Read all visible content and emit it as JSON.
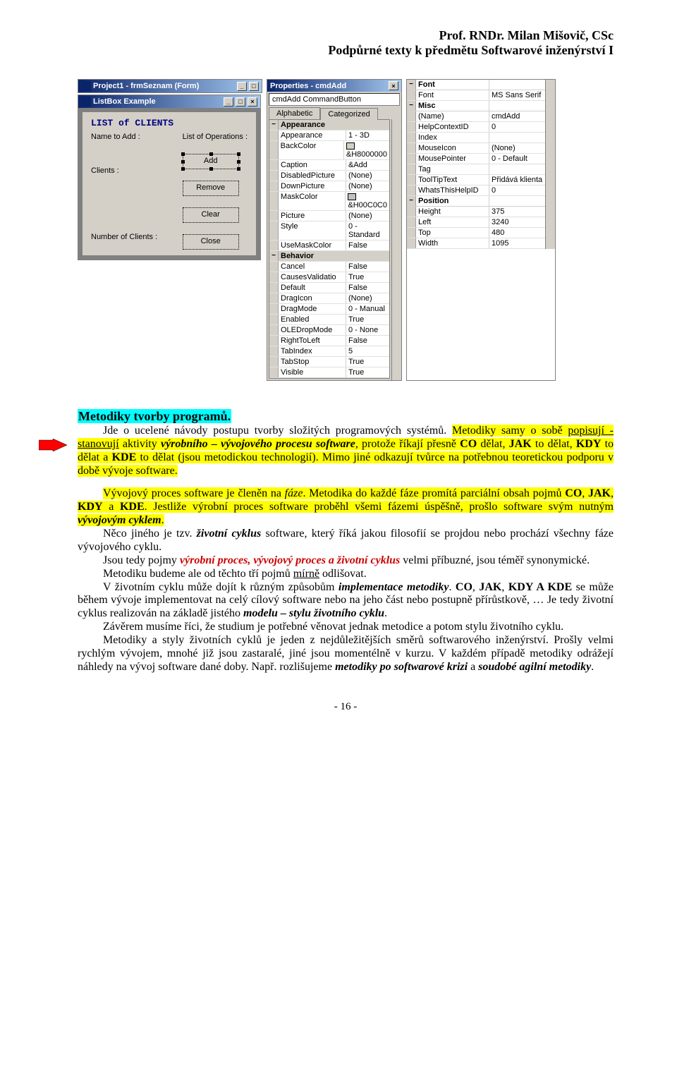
{
  "header": {
    "l1": "Prof. RNDr. Milan  Mišovič, CSc",
    "l2": "Podpůrné texty k předmětu  Softwarové inženýrství I"
  },
  "form1": {
    "title": "Project1 - frmSeznam (Form)",
    "btns": {
      "min": "_",
      "max": "□"
    }
  },
  "listbox": {
    "title": "ListBox Example",
    "btns": {
      "min": "_",
      "max": "□",
      "close": "×"
    },
    "caption": "LIST  of  CLIENTS",
    "ops_label": "List of Operations :",
    "name_label": "Name to Add :",
    "clients_label": "Clients :",
    "num_label": "Number of Clients :",
    "btn_add": "Add",
    "btn_remove": "Remove",
    "btn_clear": "Clear",
    "btn_close": "Close"
  },
  "prop": {
    "title": "Properties - cmdAdd",
    "close": "×",
    "combo": "cmdAdd  CommandButton",
    "tab_a": "Alphabetic",
    "tab_c": "Categorized",
    "minus": "−",
    "cats": {
      "app": "Appearance",
      "beh": "Behavior"
    },
    "rows": [
      {
        "k": "Appearance",
        "v": "1 - 3D"
      },
      {
        "k": "BackColor",
        "v": "&H8000000"
      },
      {
        "k": "Caption",
        "v": "&Add"
      },
      {
        "k": "DisabledPicture",
        "v": "(None)"
      },
      {
        "k": "DownPicture",
        "v": "(None)"
      },
      {
        "k": "MaskColor",
        "v": "&H00C0C0"
      },
      {
        "k": "Picture",
        "v": "(None)"
      },
      {
        "k": "Style",
        "v": "0 - Standard"
      },
      {
        "k": "UseMaskColor",
        "v": "False"
      },
      {
        "k": "Cancel",
        "v": "False"
      },
      {
        "k": "CausesValidatio",
        "v": "True"
      },
      {
        "k": "Default",
        "v": "False"
      },
      {
        "k": "DragIcon",
        "v": "(None)"
      },
      {
        "k": "DragMode",
        "v": "0 - Manual"
      },
      {
        "k": "Enabled",
        "v": "True"
      },
      {
        "k": "OLEDropMode",
        "v": "0 - None"
      },
      {
        "k": "RightToLeft",
        "v": "False"
      },
      {
        "k": "TabIndex",
        "v": "5"
      },
      {
        "k": "TabStop",
        "v": "True"
      },
      {
        "k": "Visible",
        "v": "True"
      }
    ]
  },
  "prop2": {
    "minus": "−",
    "cats": {
      "font": "Font",
      "misc": "Misc",
      "pos": "Position"
    },
    "rows": {
      "Font": "MS Sans Serif",
      "Name": "cmdAdd",
      "HelpContextID": "0",
      "Index": "",
      "MouseIcon": "(None)",
      "MousePointer": "0 - Default",
      "Tag": "",
      "ToolTipText": "Přidává klienta",
      "WhatsThisHelpID": "0",
      "Height": "375",
      "Left": "3240",
      "Top": "480",
      "Width": "1095"
    },
    "name_key": "(Name)"
  },
  "title": "Metodiky tvorby programů.",
  "para": {
    "p1": "Jde o ucelené návody postupu tvorby složitých programových systémů. ",
    "p2a": "Metodiky samy o sobě ",
    "p2b": "popisují - stanovují",
    "p2c": " aktivity ",
    "p2d": "výrobního – vývojového procesu software",
    "p2e": ", protože říkají přesně ",
    "p2f": "CO",
    "p2g": " dělat, ",
    "p2h": "JAK",
    "p2i": " to dělat, ",
    "p2j": "KDY",
    "p2k": " to dělat a ",
    "p2l": "KDE",
    "p2m": " to dělat (jsou metodickou technologií).",
    "p3": " Mimo jiné odkazují tvůrce na potřebnou teoretickou podporu v době vývoje software.",
    "p4a": "Vývojový proces software je členěn na ",
    "p4b": "fáze",
    "p4c": ". Metodika do každé fáze promítá parciální obsah pojmů ",
    "p4d": "CO",
    "p4e": ", ",
    "p4f": "JAK",
    "p4g": ", ",
    "p4h": "KDY",
    "p4i": " a ",
    "p4j": "KDE",
    "p4k": ".",
    "p5a": " Jestliže výrobní proces software proběhl všemi fázemi úspěšně, prošlo software svým nutným ",
    "p5b": "vývojovým cyklem",
    "p5c": ".",
    "p6a": "Něco jiného je tzv. ",
    "p6b": "životní cyklus",
    "p6c": " software, který říká jakou filosofií se projdou nebo prochází všechny fáze vývojového cyklu.",
    "p7a": "Jsou tedy pojmy ",
    "p7b": "výrobní proces, vývojový proces a životní cyklus",
    "p7c": " velmi příbuzné, jsou téměř synonymické.",
    "p8a": "Metodiku budeme ale od těchto tří pojmů ",
    "p8b": "mírně",
    "p8c": " odlišovat.",
    "p9a": "V životním cyklu může dojít k různým způsobům ",
    "p9b": "implementace metodiky",
    "p9c": ". ",
    "p9d": "CO",
    "p9e": ", ",
    "p9f": "JAK",
    "p9g": ", ",
    "p9h": "KDY A KDE",
    "p9i": " se může během vývoje implementovat na celý cílový software nebo na jeho část nebo postupně přírůstkově, … Je tedy životní cyklus realizován na základě jistého ",
    "p9j": "modelu – stylu životního cyklu",
    "p9k": ".",
    "p10": "Závěrem musíme říci, že studium je potřebné věnovat jednak metodice a potom stylu životního cyklu.",
    "p11a": "Metodiky a styly životních cyklů je jeden z nejdůležitějších směrů softwarového inženýrství. Prošly velmi rychlým vývojem, mnohé již jsou zastaralé, jiné jsou momentélně v kurzu. V každém případě metodiky odrážejí náhledy na vývoj software dané doby. Např. rozlišujeme ",
    "p11b": "metodiky po softwarové krizi",
    "p11c": " a ",
    "p11d": "soudobé agilní metodiky",
    "p11e": "."
  },
  "footer": "- 16 -"
}
